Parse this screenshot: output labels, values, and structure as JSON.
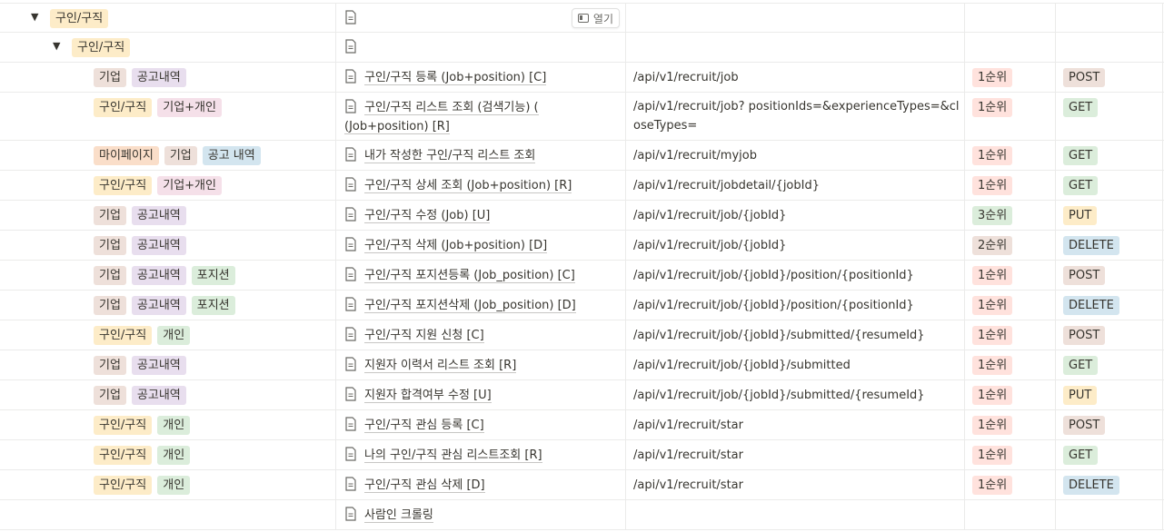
{
  "group_top": {
    "label": "구인/구직",
    "color": "#fdecc8"
  },
  "group_sub": {
    "label": "구인/구직",
    "color": "#fdecc8"
  },
  "open_button": "열기",
  "tag_colors": {
    "기업": "#eee0da",
    "공고내역": "#e8deee",
    "공고 내역": "#d3e5ef",
    "구인/구직": "#fdecc8",
    "기업+개인": "#f5e0e9",
    "마이페이지": "#fadec9",
    "포지션": "#dbeddb",
    "개인": "#dbeddb"
  },
  "priority_colors": {
    "1순위": "#ffe2dd",
    "2순위": "#eee0da",
    "3순위": "#dbeddb"
  },
  "method_colors": {
    "POST": "#eee0da",
    "GET": "#dbeddb",
    "PUT": "#fdecc8",
    "DELETE": "#d3e5ef"
  },
  "rows": [
    {
      "tags": [
        "기업",
        "공고내역"
      ],
      "title": "구인/구직 등록 (Job+position) [C]",
      "url": "/api/v1/recruit/job",
      "priority": "1순위",
      "method": "POST"
    },
    {
      "tags": [
        "구인/구직",
        "기업+개인"
      ],
      "title": "구인/구직 리스트 조회 (검색기능) ( (Job+position) [R]",
      "url": "/api/v1/recruit/job? positionIds=&experienceTypes=&closeTypes=",
      "priority": "1순위",
      "method": "GET",
      "tall": true
    },
    {
      "tags": [
        "마이페이지",
        "기업",
        "공고 내역"
      ],
      "title": "내가 작성한 구인/구직 리스트 조회",
      "url": "/api/v1/recruit/myjob",
      "priority": "1순위",
      "method": "GET"
    },
    {
      "tags": [
        "구인/구직",
        "기업+개인"
      ],
      "title": "구인/구직 상세 조회 (Job+position) [R]",
      "url": "/api/v1/recruit/jobdetail/{jobId}",
      "priority": "1순위",
      "method": "GET"
    },
    {
      "tags": [
        "기업",
        "공고내역"
      ],
      "title": "구인/구직 수정 (Job) [U]",
      "url": "/api/v1/recruit/job/{jobId}",
      "priority": "3순위",
      "method": "PUT"
    },
    {
      "tags": [
        "기업",
        "공고내역"
      ],
      "title": "구인/구직 삭제 (Job+position) [D]",
      "url": "/api/v1/recruit/job/{jobId}",
      "priority": "2순위",
      "method": "DELETE"
    },
    {
      "tags": [
        "기업",
        "공고내역",
        "포지션"
      ],
      "title": "구인/구직 포지션등록 (Job_position) [C]",
      "url": "/api/v1/recruit/job/{jobId}/position/{positionId}",
      "priority": "1순위",
      "method": "POST"
    },
    {
      "tags": [
        "기업",
        "공고내역",
        "포지션"
      ],
      "title": "구인/구직 포지션삭제 (Job_position) [D]",
      "url": "/api/v1/recruit/job/{jobId}/position/{positionId}",
      "priority": "1순위",
      "method": "DELETE"
    },
    {
      "tags": [
        "구인/구직",
        "개인"
      ],
      "title": "구인/구직 지원 신청 [C]",
      "url": "/api/v1/recruit/job/{jobId}/submitted/{resumeId}",
      "priority": "1순위",
      "method": "POST"
    },
    {
      "tags": [
        "기업",
        "공고내역"
      ],
      "title": "지원자 이력서 리스트 조회 [R]",
      "url": "/api/v1/recruit/job/{jobId}/submitted",
      "priority": "1순위",
      "method": "GET"
    },
    {
      "tags": [
        "기업",
        "공고내역"
      ],
      "title": "지원자 합격여부 수정 [U]",
      "url": "/api/v1/recruit/job/{jobId}/submitted/{resumeId}",
      "priority": "1순위",
      "method": "PUT"
    },
    {
      "tags": [
        "구인/구직",
        "개인"
      ],
      "title": "구인/구직 관심 등록 [C]",
      "url": "/api/v1/recruit/star",
      "priority": "1순위",
      "method": "POST"
    },
    {
      "tags": [
        "구인/구직",
        "개인"
      ],
      "title": "나의 구인/구직 관심 리스트조회 [R]",
      "url": "/api/v1/recruit/star",
      "priority": "1순위",
      "method": "GET"
    },
    {
      "tags": [
        "구인/구직",
        "개인"
      ],
      "title": "구인/구직 관심 삭제 [D]",
      "url": "/api/v1/recruit/star",
      "priority": "1순위",
      "method": "DELETE"
    },
    {
      "tags": [],
      "title": "사람인 크롤링",
      "url": "",
      "priority": "",
      "method": ""
    }
  ]
}
